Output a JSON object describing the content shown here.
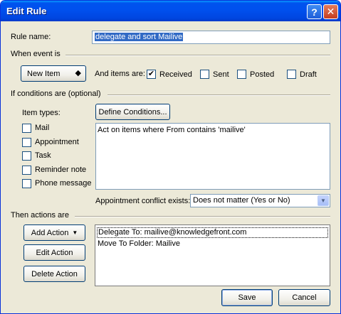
{
  "window": {
    "title": "Edit Rule",
    "help_glyph": "?",
    "close_glyph": "✕"
  },
  "rule_name": {
    "label": "Rule name:",
    "value": "delegate and sort Mailive"
  },
  "when_event": {
    "heading": "When event is",
    "event_button": "New Item",
    "event_arrows": "◆",
    "items_are_label": "And items are:",
    "options": [
      {
        "label": "Received",
        "checked": true
      },
      {
        "label": "Sent",
        "checked": false
      },
      {
        "label": "Posted",
        "checked": false
      },
      {
        "label": "Draft",
        "checked": false
      }
    ]
  },
  "conditions": {
    "heading": "If conditions are  (optional)",
    "item_types_label": "Item types:",
    "item_types": [
      {
        "label": "Mail",
        "checked": false
      },
      {
        "label": "Appointment",
        "checked": false
      },
      {
        "label": "Task",
        "checked": false
      },
      {
        "label": "Reminder note",
        "checked": false
      },
      {
        "label": "Phone message",
        "checked": false
      }
    ],
    "define_button": "Define Conditions...",
    "description": "Act on items where From  contains 'mailive'",
    "conflict_label": "Appointment conflict exists:",
    "conflict_value": "Does not matter (Yes or No)",
    "conflict_arrow": "▼"
  },
  "actions": {
    "heading": "Then actions are",
    "add_button": "Add Action",
    "add_arrow": "▼",
    "edit_button": "Edit Action",
    "delete_button": "Delete Action",
    "list": [
      "Delegate To: mailive@knowledgefront.com",
      "Move To Folder: Mailive"
    ]
  },
  "footer": {
    "save": "Save",
    "cancel": "Cancel"
  },
  "check_glyph": "✔"
}
